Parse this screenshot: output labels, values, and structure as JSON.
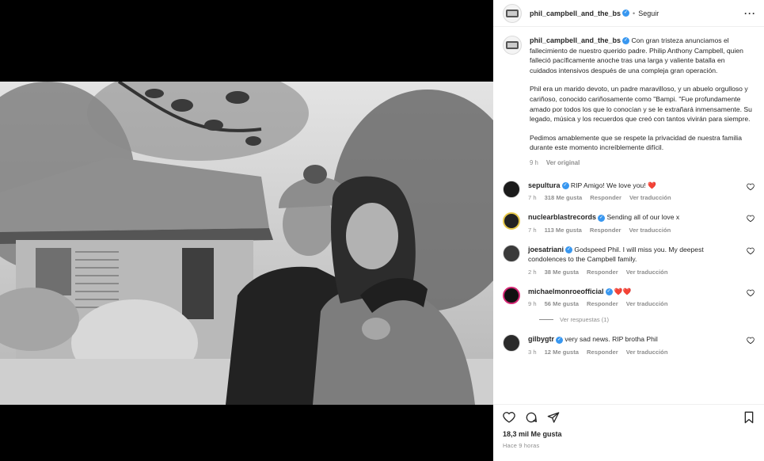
{
  "post": {
    "username": "phil_campbell_and_the_bs",
    "follow_label": "Seguir",
    "more_label": "···",
    "caption_paragraphs": [
      "Con gran tristeza anunciamos el fallecimiento de nuestro querido padre. Philip Anthony Campbell, quien falleció pacíficamente anoche tras una larga y valiente batalla en cuidados intensivos después de una compleja gran operación.",
      "Phil era un marido devoto, un padre maravilloso, y un abuelo orgulloso y cariñoso, conocido cariñosamente como \"Bampi. \"Fue profundamente amado por todos los que lo conocían y se le extrañará inmensamente. Su legado, música y los recuerdos que creó con tantos vivirán para siempre.",
      "Pedimos amablemente que se respete la privacidad de nuestra familia durante este momento increíblemente difícil."
    ],
    "caption_time": "9 h",
    "see_original": "Ver original",
    "likes": "18,3 mil Me gusta",
    "posted_ago": "Hace 9 horas"
  },
  "comments": [
    {
      "user": "sepultura",
      "text": "RIP Amigo! We love you! ❤️",
      "time": "7 h",
      "likes": "318 Me gusta",
      "reply": "Responder",
      "translate": "Ver traducción"
    },
    {
      "user": "nuclearblastrecords",
      "text": "Sending all of our love x",
      "time": "7 h",
      "likes": "113 Me gusta",
      "reply": "Responder",
      "translate": "Ver traducción"
    },
    {
      "user": "joesatriani",
      "text": "Godspeed Phil. I will miss you. My deepest condolences to the Campbell family.",
      "time": "2 h",
      "likes": "38 Me gusta",
      "reply": "Responder",
      "translate": "Ver traducción"
    },
    {
      "user": "michaelmonroeofficial",
      "text": "❤️❤️",
      "time": "9 h",
      "likes": "56 Me gusta",
      "reply": "Responder",
      "translate": "Ver traducción",
      "replies_label": "Ver respuestas (1)"
    },
    {
      "user": "gilbygtr",
      "text": "very sad news. RIP brotha Phil",
      "time": "3 h",
      "likes": "12 Me gusta",
      "reply": "Responder",
      "translate": "Ver traducción"
    }
  ],
  "colors": {
    "accent_verified": "#3897f0",
    "muted": "#8e8e8e",
    "heart_red": "#ed4956"
  },
  "icons": [
    "more-icon",
    "verified-icon",
    "heart-icon",
    "comment-icon",
    "share-icon",
    "bookmark-icon"
  ]
}
